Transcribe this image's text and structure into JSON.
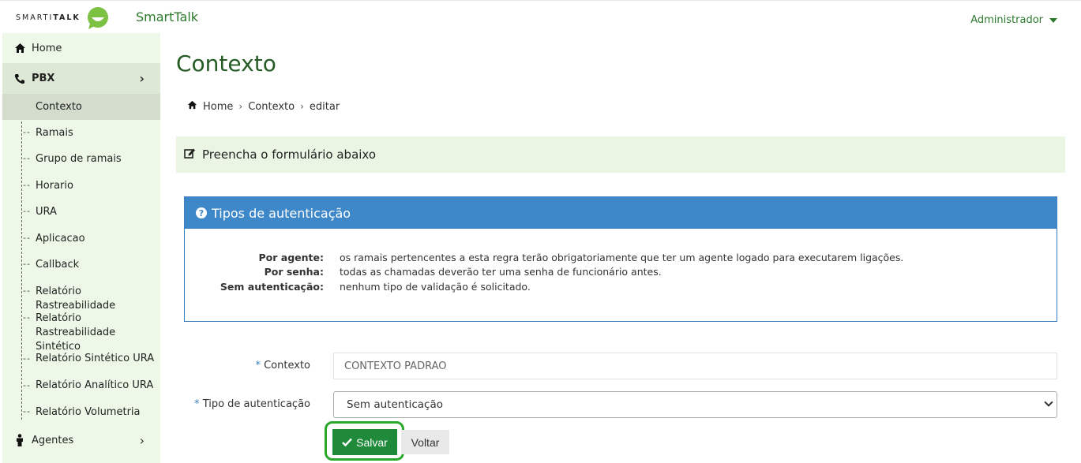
{
  "header": {
    "brand_text_light": "SMARTI",
    "brand_text_bold": "TALK",
    "app_title": "SmartTalk",
    "user_menu": "Administrador"
  },
  "sidebar": {
    "items": [
      {
        "label": "Home",
        "icon": "home-icon"
      },
      {
        "label": "PBX",
        "icon": "phone-icon"
      },
      {
        "label": "Agentes",
        "icon": "person-icon"
      }
    ],
    "pbx_sub": [
      "Contexto",
      "Ramais",
      "Grupo de ramais",
      "Horario",
      "URA",
      "Aplicacao",
      "Callback",
      "Relatório Rastreabilidade",
      "Relatório Rastreabilidade Sintético",
      "Relatório Sintético URA",
      "Relatório Analítico URA",
      "Relatório Volumetria"
    ],
    "active_sub": "Contexto"
  },
  "main": {
    "title": "Contexto",
    "breadcrumb": [
      "Home",
      "Contexto",
      "editar"
    ],
    "form_header": "Preencha o formulário abaixo",
    "info_panel": {
      "title": "Tipos de autenticação",
      "rows": [
        {
          "term": "Por agente:",
          "def": "os ramais pertencentes a esta regra terão obrigatoriamente que ter um agente logado para executarem ligações."
        },
        {
          "term": "Por senha:",
          "def": "todas as chamadas deverão ter uma senha de funcionário antes."
        },
        {
          "term": "Sem autenticação:",
          "def": "nenhum tipo de validação é solicitado."
        }
      ]
    },
    "form": {
      "required_mark": "*",
      "contexto_label": "Contexto",
      "contexto_value": "CONTEXTO PADRAO",
      "tipo_label": "Tipo de autenticação",
      "tipo_value": "Sem autenticação"
    },
    "buttons": {
      "save": "Salvar",
      "back": "Voltar"
    }
  },
  "colors": {
    "brand_green": "#2b7a2b",
    "sidebar_bg": "#eef8e8",
    "panel_blue": "#3e87c8",
    "save_green": "#1f8a3a"
  }
}
